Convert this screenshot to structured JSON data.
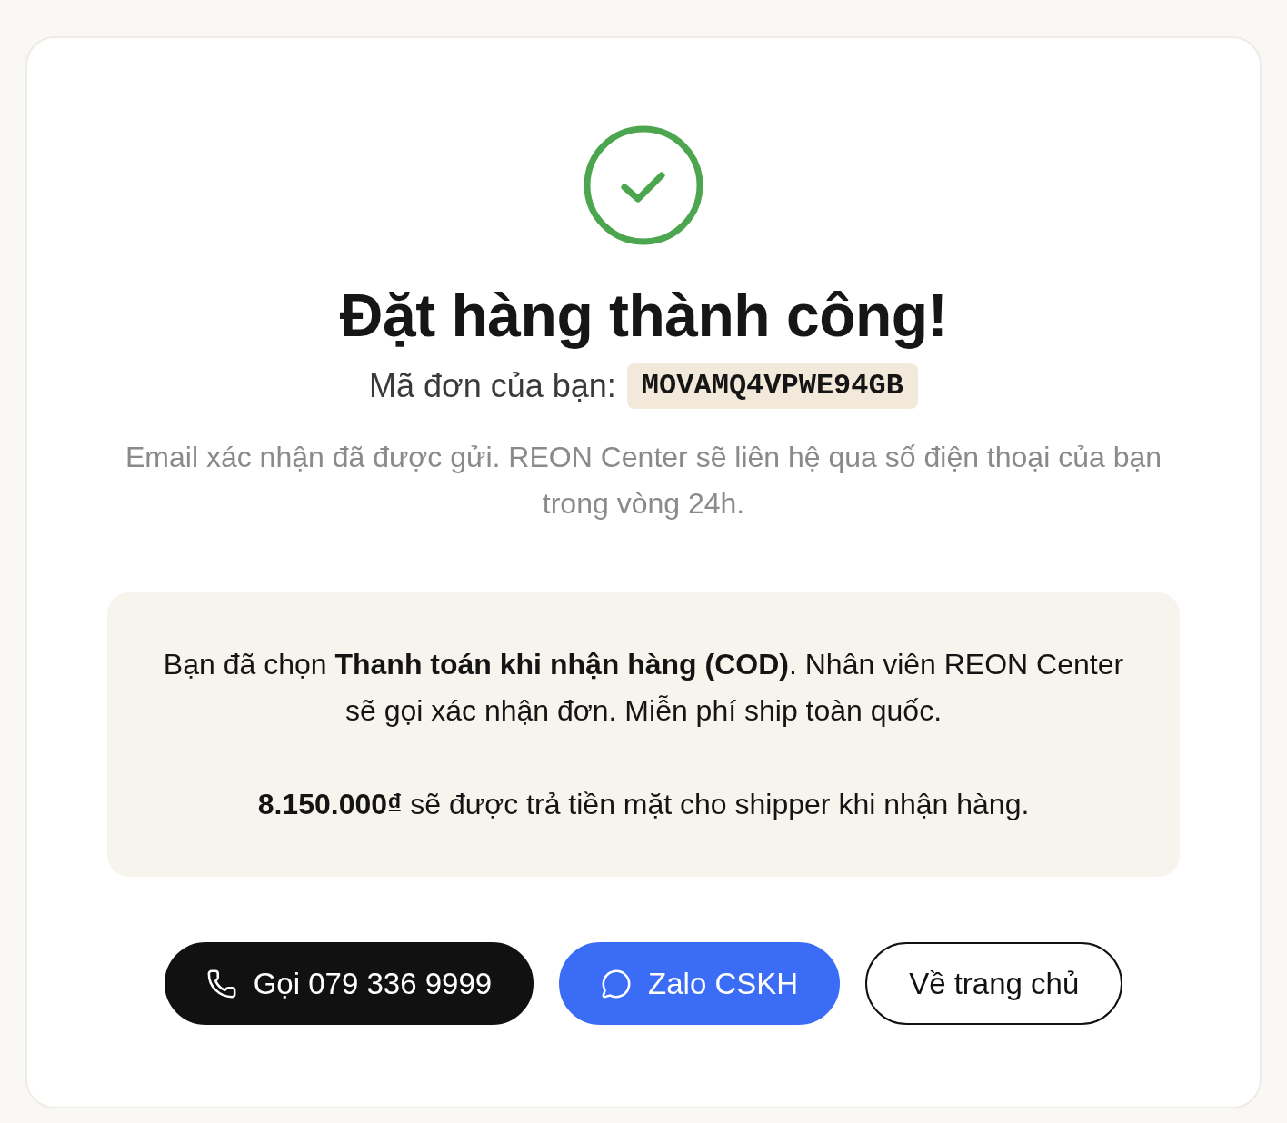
{
  "title": "Đặt hàng thành công!",
  "order_code": {
    "label": "Mã đơn của bạn:",
    "value": "MOVAMQ4VPWE94GB"
  },
  "confirmation_note": "Email xác nhận đã được gửi. REON Center sẽ liên hệ qua số điện thoại của bạn trong vòng 24h.",
  "payment_info": {
    "paragraphs": [
      "Bạn đã chọn **Thanh toán khi nhận hàng (COD)**. Nhân viên REON Center sẽ gọi xác nhận đơn. Miễn phí ship toàn quốc.",
      "**8.150.000₫** sẽ được trả tiền mặt cho shipper khi nhận hàng."
    ]
  },
  "buttons": [
    {
      "kind": "call",
      "label": "Gọi 079 336 9999"
    },
    {
      "kind": "chat",
      "label": "Zalo CSKH"
    },
    {
      "kind": "home",
      "label": "Về trang chủ"
    }
  ]
}
